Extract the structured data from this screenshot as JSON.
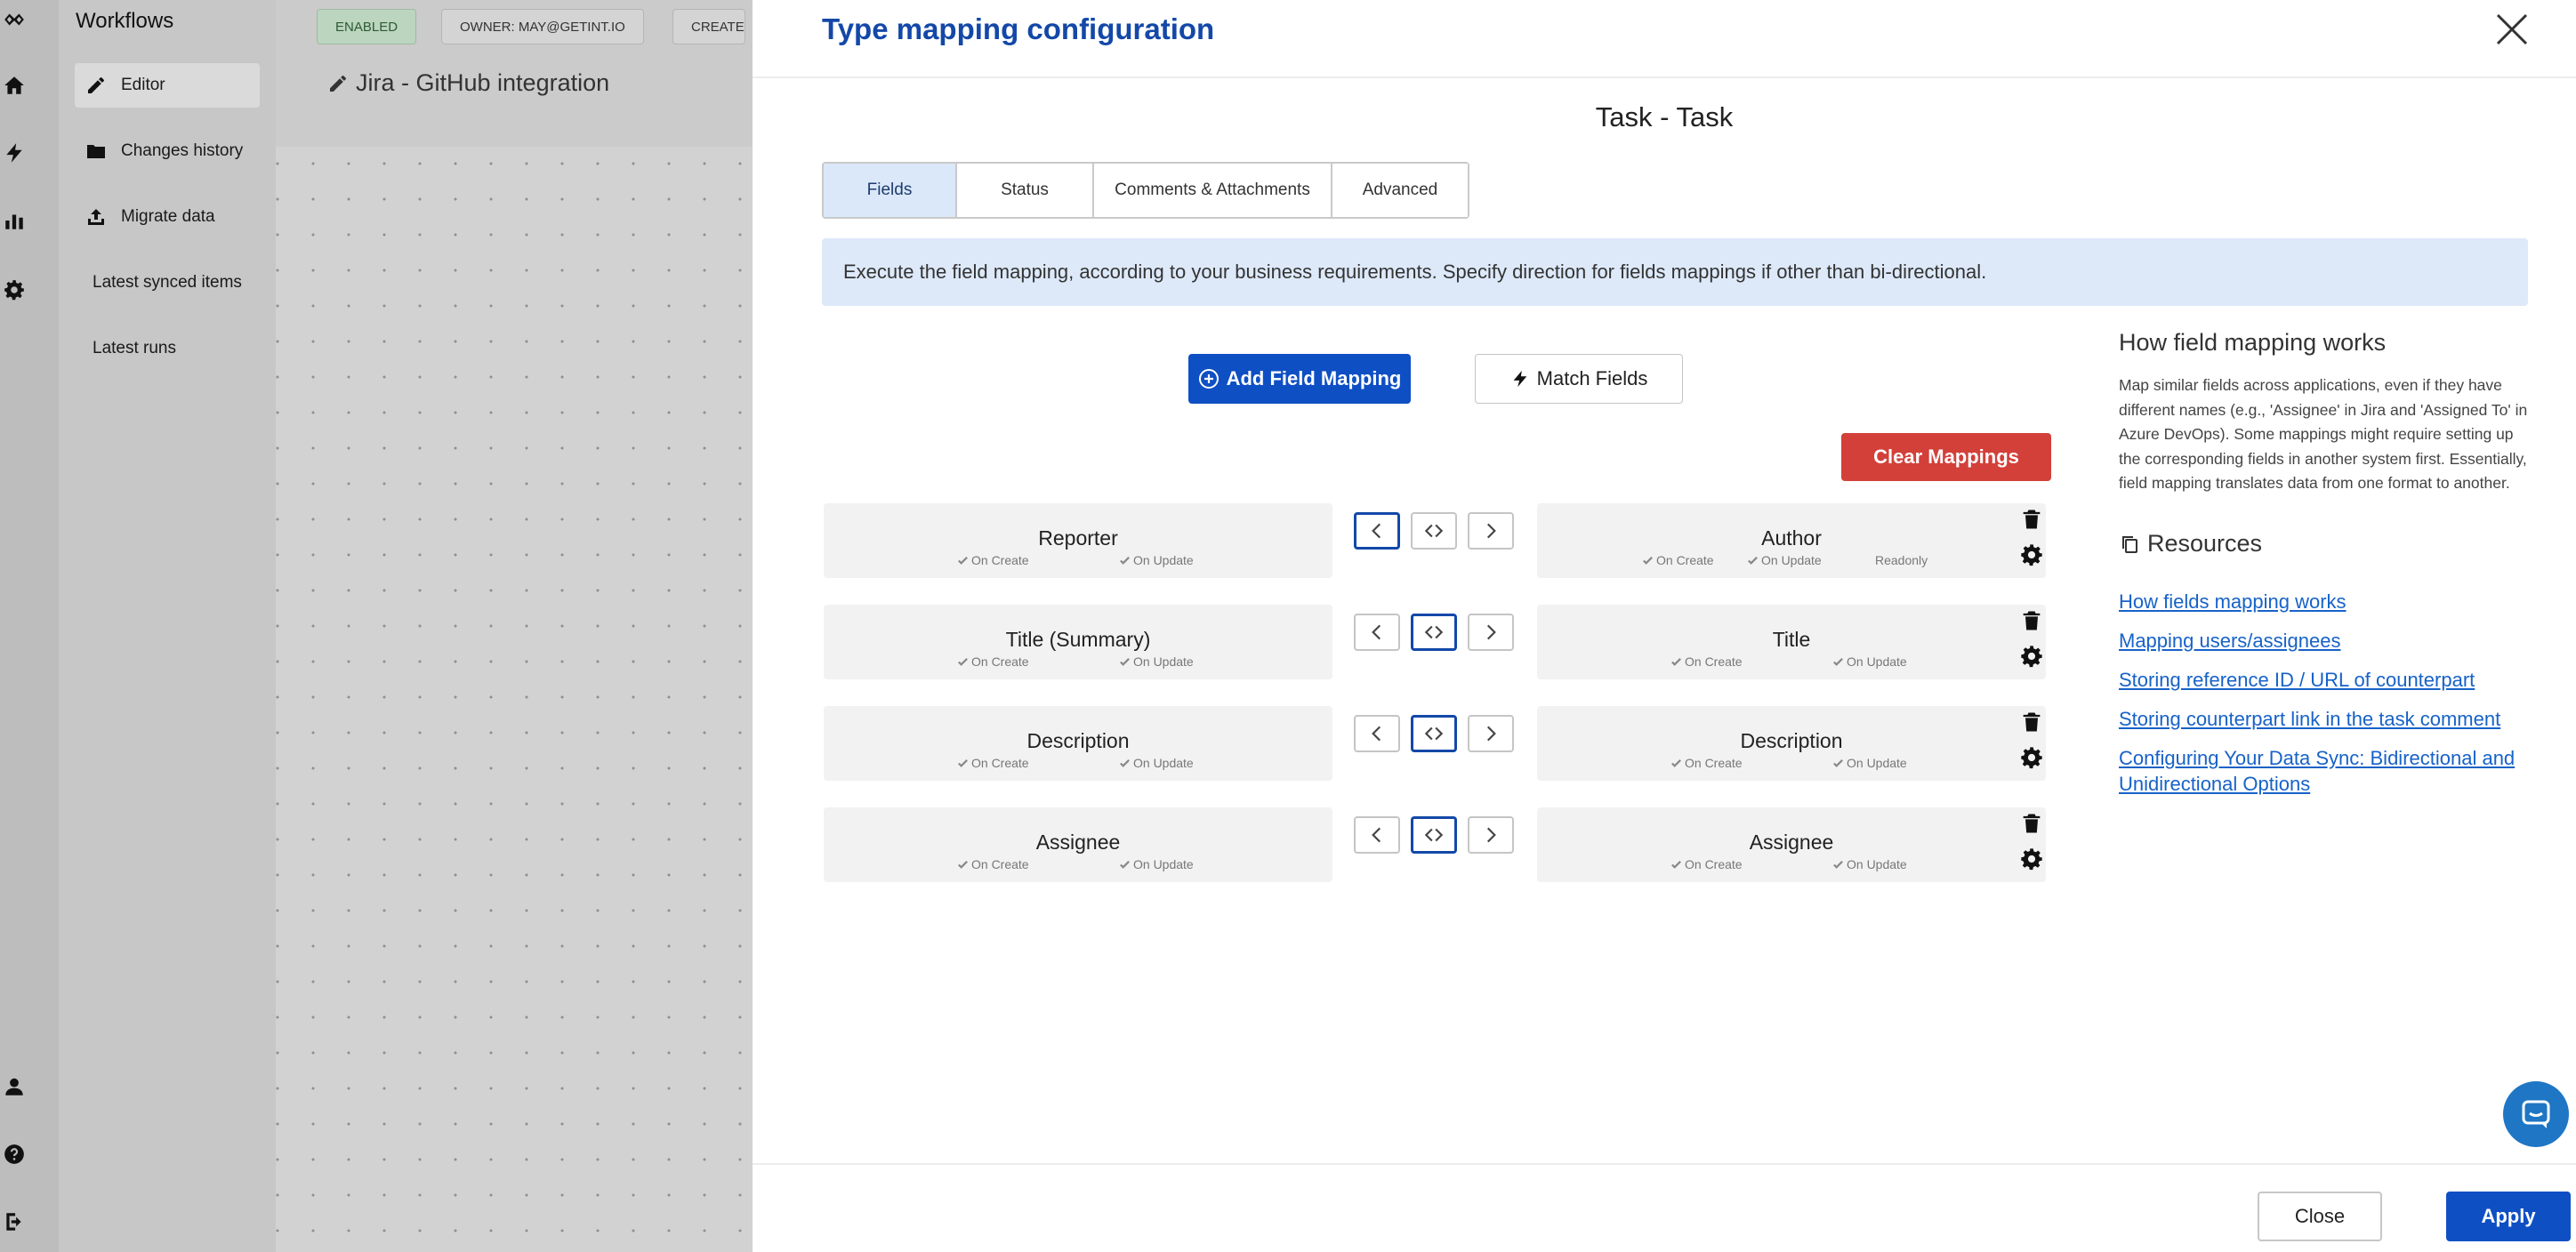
{
  "sidebar": {
    "title": "Workflows",
    "items": [
      {
        "label": "Editor",
        "icon": "pencil-icon"
      },
      {
        "label": "Changes history",
        "icon": "folder-icon"
      },
      {
        "label": "Migrate data",
        "icon": "upload-icon"
      },
      {
        "label": "Latest synced items"
      },
      {
        "label": "Latest runs"
      }
    ]
  },
  "workflow": {
    "badges": [
      "ENABLED",
      "OWNER: MAY@GETINT.IO",
      "CREATED"
    ],
    "name": "Jira - GitHub integration"
  },
  "modal": {
    "title": "Type mapping configuration",
    "subtitle": "Task - Task",
    "tabs": [
      "Fields",
      "Status",
      "Comments & Attachments",
      "Advanced"
    ],
    "active_tab": "Fields",
    "info": "Execute the field mapping, according to your business requirements. Specify direction for fields mappings if other than bi-directional.",
    "add_label": "Add Field Mapping",
    "match_label": "Match Fields",
    "clear_label": "Clear Mappings",
    "on_create": "On Create",
    "on_update": "On Update",
    "mappings": [
      {
        "left": "Reporter",
        "right": "Author",
        "right_readonly": "Readonly",
        "direction": "left"
      },
      {
        "left": "Title (Summary)",
        "right": "Title",
        "direction": "both"
      },
      {
        "left": "Description",
        "right": "Description",
        "direction": "both"
      },
      {
        "left": "Assignee",
        "right": "Assignee",
        "direction": "both"
      }
    ],
    "help": {
      "title": "How field mapping works",
      "text": "Map similar fields across applications, even if they have different names (e.g., 'Assignee' in Jira and 'Assigned To' in Azure DevOps). Some mappings might require setting up the corresponding fields in another system first. Essentially, field mapping translates data from one format to another.",
      "resources_title": "Resources",
      "links": [
        "How fields mapping works",
        "Mapping users/assignees",
        "Storing reference ID / URL of counterpart",
        "Storing counterpart link in the task comment",
        "Configuring Your Data Sync: Bidirectional and Unidirectional Options"
      ]
    },
    "close_label": "Close",
    "apply_label": "Apply"
  },
  "colors": {
    "accent": "#0f4fc4",
    "title": "#1348a8",
    "danger": "#d3403a",
    "info_bg": "#dde9f9",
    "link": "#1762c8"
  }
}
